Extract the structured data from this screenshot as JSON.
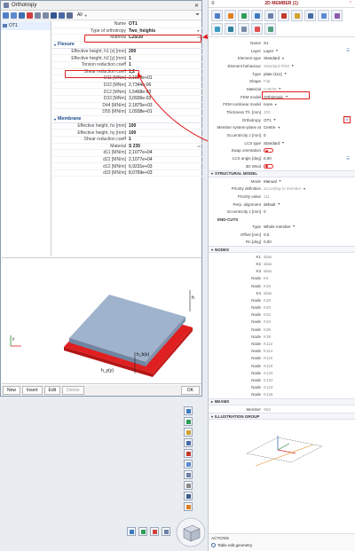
{
  "dialog": {
    "title": "Orthotropy",
    "close_label": "✕",
    "filter_label": "All",
    "list_item": "OT1",
    "props": [
      {
        "label": "Name",
        "value": "OT1"
      },
      {
        "label": "Type of orthotropy",
        "value": "Two_heights"
      },
      {
        "label": "Material",
        "value": "C25/30"
      }
    ],
    "flexure_label": "Flexure",
    "flexure": [
      {
        "label": "Effective height, h1 [x] [mm]",
        "value": "200"
      },
      {
        "label": "Effective height, h2 [y] [mm]",
        "value": "1"
      },
      {
        "label": "Torsion reduction coeff",
        "value": "1"
      },
      {
        "label": "Shear reduction coeff",
        "value": "1,2"
      },
      {
        "label": "D11 [MNm]",
        "value": "2,1875e+01"
      },
      {
        "label": "D22 [MNm]",
        "value": "2,7344e-06"
      },
      {
        "label": "D12 [MNm]",
        "value": "1,5468e-03"
      },
      {
        "label": "D33 [MNm]",
        "value": "3,0936e-03"
      },
      {
        "label": "D44 [MN/m]",
        "value": "2,1875e+03"
      },
      {
        "label": "D55 [MN/m]",
        "value": "1,0938e+01"
      }
    ],
    "membrane_label": "Membrane",
    "membrane": [
      {
        "label": "Effective height, hx [mm]",
        "value": "100"
      },
      {
        "label": "Effective height, hy [mm]",
        "value": "100"
      },
      {
        "label": "Shear reduction coeff",
        "value": "1"
      },
      {
        "label": "Material",
        "value": "S 235"
      },
      {
        "label": "d11 [MN/m]",
        "value": "2,1077e+04"
      },
      {
        "label": "d22 [MN/m]",
        "value": "2,1077e+04"
      },
      {
        "label": "d12 [MN/m]",
        "value": "6,9231e+03"
      },
      {
        "label": "d33 [MN/m]",
        "value": "8,0769e+03"
      }
    ],
    "preview_labels": {
      "h1": "h",
      "h2": "h",
      "hb": "h_b(x)",
      "hy": "h_y(y)",
      "y": "y"
    },
    "footer": {
      "new": "New",
      "insert": "Insert",
      "edit": "Edit",
      "delete": "Delete",
      "ok": "OK"
    }
  },
  "panel": {
    "title": "2D MEMBER (1)",
    "props": [
      {
        "label": "Name",
        "value": "S1",
        "grey": false
      },
      {
        "label": "Layer",
        "value": "Layer",
        "dd": true
      },
      {
        "label": "Element type",
        "value": "Standard",
        "dd": true
      },
      {
        "label": "Element behaviour",
        "value": "Standard FEM",
        "dd": true,
        "grey": true
      },
      {
        "label": "Type",
        "value": "plate (111)",
        "dd": true
      },
      {
        "label": "Shape",
        "value": "Flat",
        "grey": true
      },
      {
        "label": "Material",
        "value": "C25/30",
        "dd": true,
        "grey": true
      },
      {
        "label": "FEM model",
        "value": "Orthotropic",
        "dd": true
      },
      {
        "label": "FEM nonlinear model",
        "value": "none",
        "dd": true
      },
      {
        "label": "Thickness Th. [mm]",
        "value": "200",
        "grey": true
      },
      {
        "label": "Orthotropy",
        "value": "OT1",
        "dd": true
      },
      {
        "label": "Member system-plane at",
        "value": "Centre",
        "dd": true
      },
      {
        "label": "Eccentricity z [mm]",
        "value": "0"
      },
      {
        "label": "LCS type",
        "value": "Standard",
        "dd": true
      },
      {
        "label": "Swap orientation",
        "value": "",
        "toggle": true
      },
      {
        "label": "LCS angle [deg]",
        "value": "0,00"
      },
      {
        "label": "3D Wind",
        "value": "",
        "toggle": true
      }
    ],
    "structural_label": "STRUCTURAL MODEL",
    "structural": [
      {
        "label": "Mode",
        "value": "Manual",
        "dd": true
      },
      {
        "label": "Priority definition",
        "value": "according to member",
        "dd": true,
        "grey": true
      },
      {
        "label": "Priority value",
        "value": "111",
        "grey": true
      },
      {
        "label": "Perp. alignment",
        "value": "default",
        "dd": true
      },
      {
        "label": "Eccentricity z [mm]",
        "value": "0"
      }
    ],
    "endcuts_label": "END-CUTS",
    "endcuts": [
      {
        "label": "Type",
        "value": "Whole member",
        "dd": true
      },
      {
        "label": "Offset [mm]",
        "value": "0,0"
      },
      {
        "label": "Rn [deg]",
        "value": "0,00"
      }
    ],
    "nodes_label": "NODES",
    "nodes": [
      {
        "label": "K1",
        "value": "alias"
      },
      {
        "label": "K2",
        "value": "alias"
      },
      {
        "label": "K3",
        "value": "alias"
      },
      {
        "label": "Node",
        "value": "K4"
      },
      {
        "label": "Node",
        "value": "K26"
      },
      {
        "label": "K4",
        "value": "alias"
      },
      {
        "label": "Node",
        "value": "K28"
      },
      {
        "label": "Node",
        "value": "K30"
      },
      {
        "label": "Node",
        "value": "K32"
      },
      {
        "label": "Node",
        "value": "K34"
      },
      {
        "label": "Node",
        "value": "K36"
      },
      {
        "label": "Node",
        "value": "K38"
      },
      {
        "label": "Node",
        "value": "K112"
      },
      {
        "label": "Node",
        "value": "K114"
      },
      {
        "label": "Node",
        "value": "K116"
      },
      {
        "label": "Node",
        "value": "K118"
      },
      {
        "label": "Node",
        "value": "K120"
      },
      {
        "label": "Node",
        "value": "K122"
      },
      {
        "label": "Node",
        "value": "K124"
      },
      {
        "label": "Node",
        "value": "K126"
      }
    ],
    "beams_label": "BEAMS",
    "beams_row": {
      "label": "Member",
      "value": "S52"
    },
    "illustration_label": "ILLUSTRATION GROUP",
    "actions_label": "ACTIONS",
    "actions_item": "Table edit geometry"
  },
  "colors": {
    "accent": "#e02020",
    "plate": "#8da3bd",
    "plate_top": "#9fb3cc",
    "plate_side": "#6f86a2"
  }
}
